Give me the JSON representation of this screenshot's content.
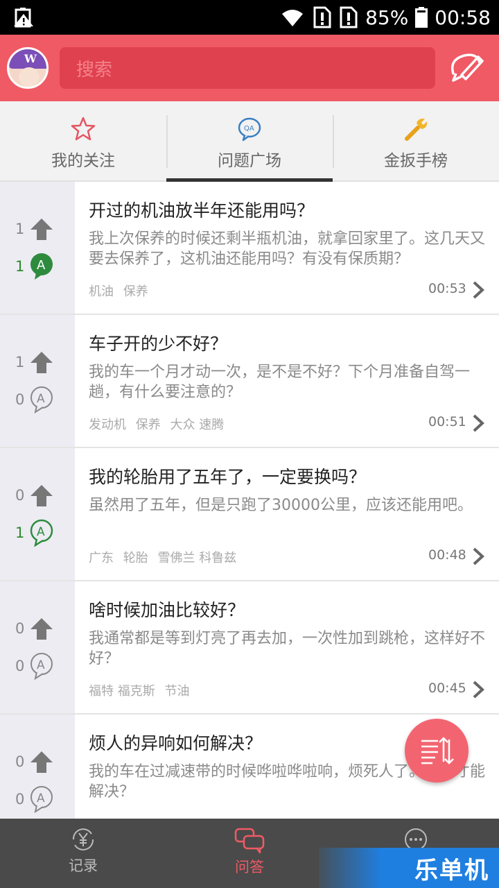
{
  "status_bar": {
    "battery_percent": "85%",
    "time": "00:58"
  },
  "header": {
    "search_placeholder": "搜索",
    "accent_color": "#f05a65"
  },
  "tabs": [
    {
      "label": "我的关注",
      "icon": "star-icon"
    },
    {
      "label": "问题广场",
      "icon": "qa-bubble-icon",
      "active": true
    },
    {
      "label": "金扳手榜",
      "icon": "wrench-icon"
    }
  ],
  "questions": [
    {
      "votes": "1",
      "answers": "1",
      "answered": true,
      "title": "开过的机油放半年还能用吗？",
      "desc": "我上次保养的时候还剩半瓶机油，就拿回家里了。这几天又要去保养了，这机油还能用吗？有没有保质期？",
      "tags": [
        "机油",
        "保养"
      ],
      "time": "00:53"
    },
    {
      "votes": "1",
      "answers": "0",
      "answered": false,
      "title": "车子开的少不好？",
      "desc": "我的车一个月才动一次，是不是不好？下个月准备自驾一趟，有什么要注意的？",
      "tags": [
        "发动机",
        "保养",
        "大众 速腾"
      ],
      "time": "00:51"
    },
    {
      "votes": "0",
      "answers": "1",
      "answered": true,
      "title": "我的轮胎用了五年了，一定要换吗？",
      "desc": "虽然用了五年，但是只跑了30000公里，应该还能用吧。",
      "tags": [
        "广东",
        "轮胎",
        "雪佛兰 科鲁兹"
      ],
      "time": "00:48"
    },
    {
      "votes": "0",
      "answers": "0",
      "answered": false,
      "title": "啥时候加油比较好？",
      "desc": "我通常都是等到灯亮了再去加，一次性加到跳枪，这样好不好？",
      "tags": [
        "福特 福克斯",
        "节油"
      ],
      "time": "00:45"
    },
    {
      "votes": "0",
      "answers": "0",
      "answered": false,
      "title": "烦人的异响如何解决？",
      "desc": "我的车在过减速带的时候哗啦哗啦响，烦死人了。怎样才能解决？",
      "tags": [],
      "time": ""
    }
  ],
  "bottom_nav": [
    {
      "label": "记录",
      "icon": "yen-cycle-icon"
    },
    {
      "label": "问答",
      "icon": "chat-bubbles-icon",
      "active": true
    },
    {
      "label": "",
      "icon": "more-dots-icon"
    }
  ],
  "watermark": "乐单机"
}
